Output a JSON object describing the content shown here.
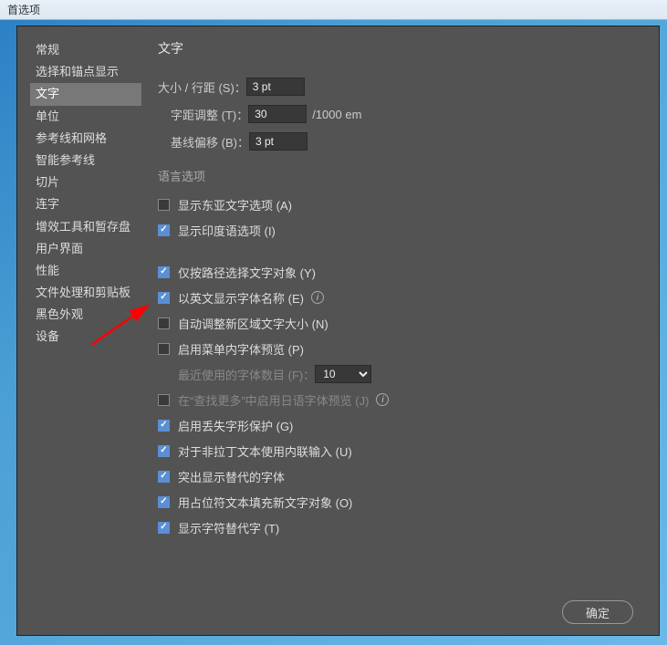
{
  "window": {
    "title": "首选项"
  },
  "sidebar": {
    "items": [
      {
        "label": "常规",
        "selected": false
      },
      {
        "label": "选择和锚点显示",
        "selected": false
      },
      {
        "label": "文字",
        "selected": true
      },
      {
        "label": "单位",
        "selected": false
      },
      {
        "label": "参考线和网格",
        "selected": false
      },
      {
        "label": "智能参考线",
        "selected": false
      },
      {
        "label": "切片",
        "selected": false
      },
      {
        "label": "连字",
        "selected": false
      },
      {
        "label": "增效工具和暂存盘",
        "selected": false
      },
      {
        "label": "用户界面",
        "selected": false
      },
      {
        "label": "性能",
        "selected": false
      },
      {
        "label": "文件处理和剪贴板",
        "selected": false
      },
      {
        "label": "黑色外观",
        "selected": false
      },
      {
        "label": "设备",
        "selected": false
      }
    ]
  },
  "content": {
    "title": "文字",
    "size_leading": {
      "label": "大小 / 行距 (S)：",
      "value": "3 pt"
    },
    "tracking": {
      "label": "字距调整 (T)：",
      "value": "30",
      "unit": "/1000 em"
    },
    "baseline": {
      "label": "基线偏移 (B)：",
      "value": "3 pt"
    },
    "lang_section": "语言选项",
    "east_asian": {
      "label": "显示东亚文字选项 (A)",
      "checked": false
    },
    "indic": {
      "label": "显示印度语选项 (I)",
      "checked": true
    },
    "select_by_path": {
      "label": "仅按路径选择文字对象 (Y)",
      "checked": true
    },
    "english_font_names": {
      "label": "以英文显示字体名称 (E)",
      "checked": true,
      "info": true
    },
    "auto_size_area": {
      "label": "自动调整新区域文字大小 (N)",
      "checked": false
    },
    "menu_font_preview": {
      "label": "启用菜单内字体预览 (P)",
      "checked": false
    },
    "recent_fonts": {
      "label": "最近使用的字体数目 (F)：",
      "value": "10"
    },
    "japanese_preview": {
      "label": "在“查找更多”中启用日语字体预览 (J)",
      "checked": false,
      "info": true
    },
    "missing_glyph": {
      "label": "启用丢失字形保护 (G)",
      "checked": true
    },
    "inline_input": {
      "label": "对于非拉丁文本使用内联输入 (U)",
      "checked": true
    },
    "highlight_sub": {
      "label": "突出显示替代的字体",
      "checked": true
    },
    "fill_placeholder": {
      "label": "用占位符文本填充新文字对象 (O)",
      "checked": true
    },
    "show_alternates": {
      "label": "显示字符替代字 (T)",
      "checked": true
    }
  },
  "footer": {
    "ok": "确定"
  }
}
